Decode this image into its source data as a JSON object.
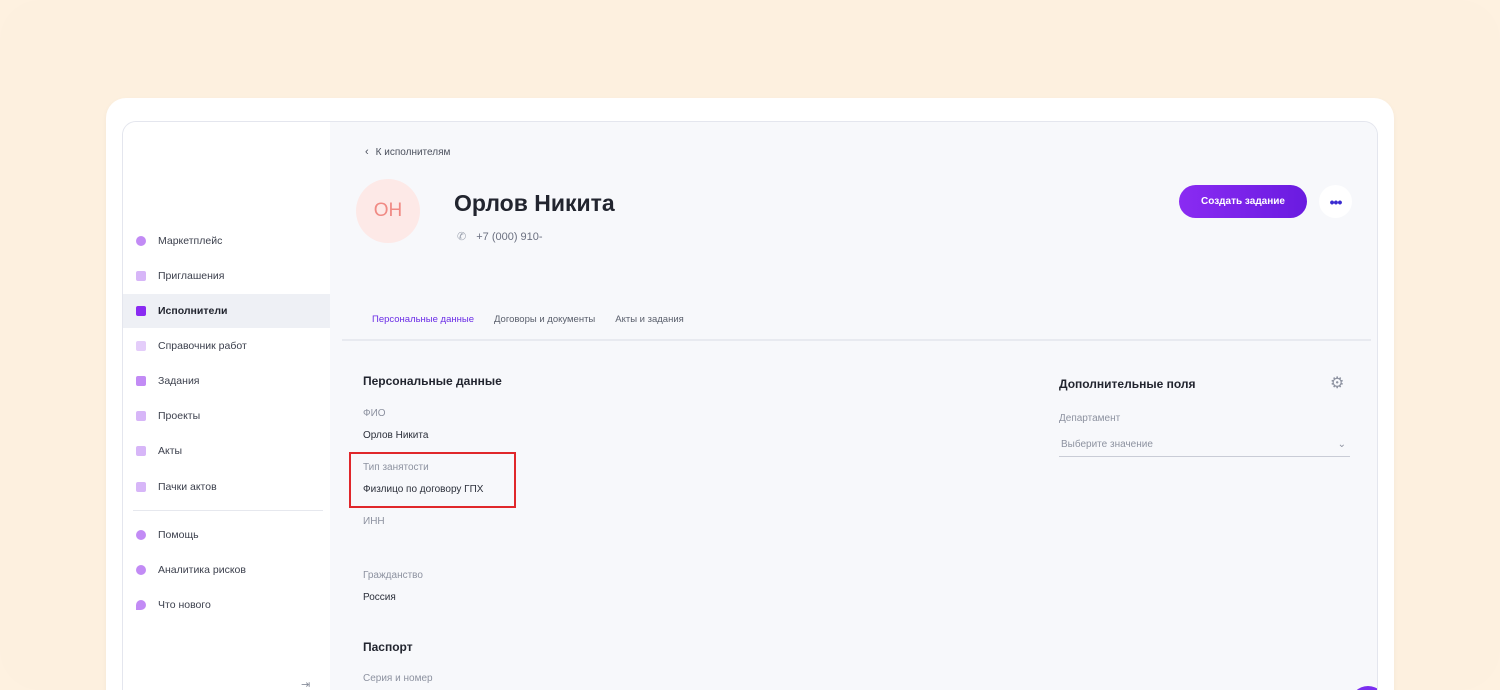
{
  "sidebar": {
    "items": [
      {
        "label": "Маркетплейс",
        "icon": "search-icon",
        "color": "#c28bf5"
      },
      {
        "label": "Приглашения",
        "icon": "user-plus-icon",
        "color": "#c28bf5"
      },
      {
        "label": "Исполнители",
        "icon": "users-icon",
        "color": "#8a2bf2"
      },
      {
        "label": "Справочник работ",
        "icon": "grid-icon",
        "color": "#c28bf5"
      },
      {
        "label": "Задания",
        "icon": "square-icon",
        "color": "#c28bf5"
      },
      {
        "label": "Проекты",
        "icon": "hierarchy-icon",
        "color": "#c28bf5"
      },
      {
        "label": "Акты",
        "icon": "document-icon",
        "color": "#c28bf5"
      },
      {
        "label": "Пачки актов",
        "icon": "documents-icon",
        "color": "#c28bf5"
      }
    ],
    "bottom_items": [
      {
        "label": "Помощь",
        "icon": "help-icon",
        "color": "#c28bf5"
      },
      {
        "label": "Аналитика рисков",
        "icon": "analytics-icon",
        "color": "#c28bf5"
      },
      {
        "label": "Что нового",
        "icon": "news-icon",
        "color": "#c28bf5"
      }
    ]
  },
  "header": {
    "back_label": "К исполнителям",
    "avatar_initials": "ОН",
    "name": "Орлов Никита",
    "phone": "+7 (000) 910-",
    "create_button": "Создать задание"
  },
  "tabs": [
    "Персональные данные",
    "Договоры и документы",
    "Акты и задания"
  ],
  "personal": {
    "title": "Персональные данные",
    "fio_label": "ФИО",
    "fio_value": "Орлов Никита",
    "employment_label": "Тип занятости",
    "employment_value": "Физлицо по договору ГПХ",
    "inn_label": "ИНН",
    "citizenship_label": "Гражданство",
    "citizenship_value": "Россия",
    "passport_title": "Паспорт",
    "passport_series_label": "Серия и номер"
  },
  "extra": {
    "title": "Дополнительные поля",
    "department_label": "Департамент",
    "department_placeholder": "Выберите значение"
  },
  "colors": {
    "accent": "#6b2de6",
    "highlight": "#e0272b"
  }
}
